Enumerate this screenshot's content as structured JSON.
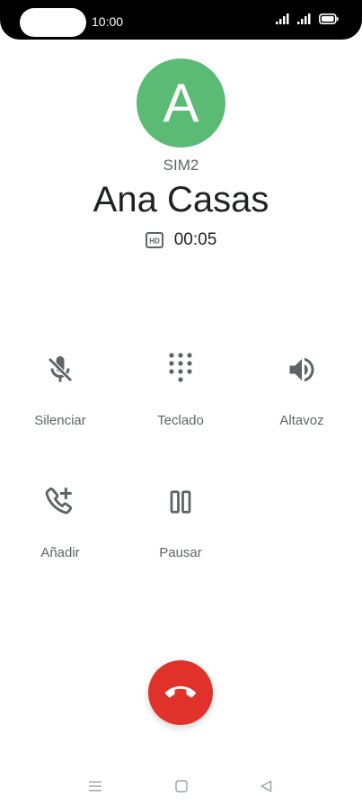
{
  "status_bar": {
    "time": "10:00",
    "icons": [
      "signal-sim1-icon",
      "signal-sim2-icon",
      "battery-icon"
    ]
  },
  "caller": {
    "avatar_letter": "A",
    "sim": "SIM2",
    "name": "Ana Casas",
    "hd_badge": "HD",
    "duration": "00:05"
  },
  "actions": [
    {
      "label": "Silenciar",
      "icon": "mic-off-icon"
    },
    {
      "label": "Teclado",
      "icon": "dialpad-icon"
    },
    {
      "label": "Altavoz",
      "icon": "speaker-icon"
    },
    {
      "label": "Añadir",
      "icon": "add-call-icon"
    },
    {
      "label": "Pausar",
      "icon": "pause-icon"
    }
  ],
  "end_call": {
    "icon": "hang-up-icon"
  },
  "nav": {
    "icons": [
      "menu-icon",
      "home-icon",
      "back-icon"
    ]
  },
  "colors": {
    "avatar": "#5bbb75",
    "end_call": "#e0322b",
    "icon_gray": "#5f6368"
  }
}
